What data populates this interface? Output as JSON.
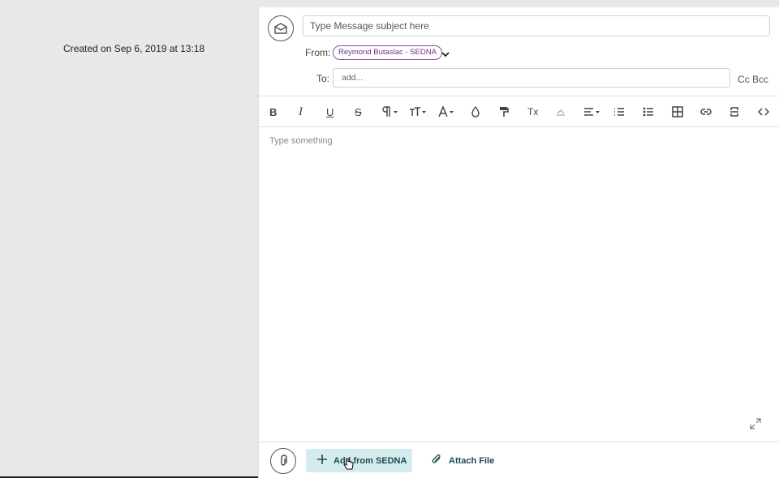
{
  "sidebar": {
    "created_text": "Created on Sep 6, 2019 at 13:18"
  },
  "composer": {
    "subject_placeholder": "Type Message subject here",
    "from_label": "From:",
    "from_value": "Reymond Butaslac - SEDNA",
    "to_label": "To:",
    "to_placeholder": "add...",
    "cc_label": "Cc",
    "bcc_label": "Bcc",
    "body_placeholder": "Type something"
  },
  "toolbar": {
    "bold": "B",
    "italic": "I",
    "underline": "U",
    "strike": "S",
    "clear_format": "Tx"
  },
  "footer": {
    "add_from_label": "Add from SEDNA",
    "attach_label": "Attach File"
  },
  "colors": {
    "accent_purple": "#8a4fa3",
    "button_teal_bg": "#d5ecef",
    "button_text": "#1d4a50"
  }
}
